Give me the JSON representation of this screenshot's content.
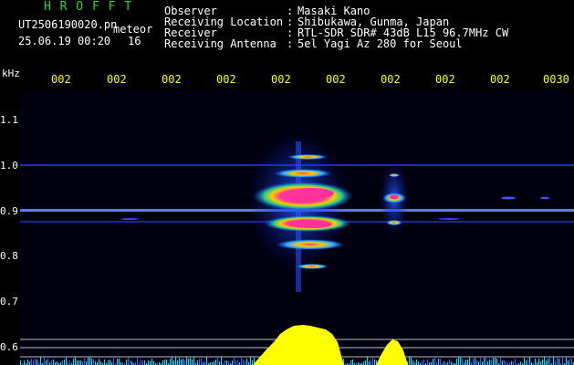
{
  "header": {
    "app_title": "H R O F F T",
    "file_name": "UT2506190020.pn",
    "file_type": "meteor",
    "date_time": "25.06.19 00:20",
    "count": "16"
  },
  "meta": [
    {
      "label": "Observer",
      "value": "Masaki Kano"
    },
    {
      "label": "Receiving Location",
      "value": "Shibukawa, Gunma, Japan"
    },
    {
      "label": "Receiver",
      "value": "RTL-SDR SDR# 43dB L15 96.7MHz CW"
    },
    {
      "label": "Receiving Antenna",
      "value": "5el Yagi Az 280 for Seoul"
    }
  ],
  "axis": {
    "y_unit": "kHz",
    "x_ticks": [
      "002",
      "002",
      "002",
      "002",
      "002",
      "002",
      "002",
      "002",
      "002",
      "0030"
    ],
    "y_ticks": [
      "1.1",
      "1.0",
      "0.9",
      "0.8",
      "0.7",
      "0.6"
    ]
  },
  "colors": {
    "background": "#000000",
    "title": "#22dd22",
    "tick_label": "#ffff00",
    "echo_hot": "#ff3399",
    "echo_warm": "#ffcc00",
    "noise": "#1e3cff",
    "audio_level": "#ffff00",
    "audio_floor": "#00e0ff"
  }
}
